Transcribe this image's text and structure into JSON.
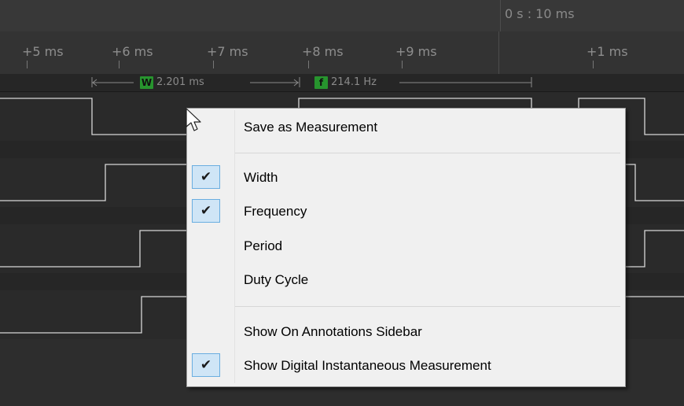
{
  "timeline": {
    "origin_label": "0 s : 10 ms",
    "ticks": [
      "+5 ms",
      "+6 ms",
      "+7 ms",
      "+8 ms",
      "+9 ms",
      "+1 ms"
    ]
  },
  "measurement_bar": {
    "width": {
      "badge": "W",
      "value": "2.201 ms"
    },
    "frequency": {
      "badge": "f",
      "value": "214.1 Hz"
    }
  },
  "context_menu": {
    "items": [
      {
        "label": "Save as Measurement",
        "checked": false
      },
      {
        "label": "Width",
        "checked": true
      },
      {
        "label": "Frequency",
        "checked": true
      },
      {
        "label": "Period",
        "checked": false
      },
      {
        "label": "Duty Cycle",
        "checked": false
      },
      {
        "label": "Show On Annotations Sidebar",
        "checked": false
      },
      {
        "label": "Show Digital Instantaneous Measurement",
        "checked": true
      }
    ],
    "check_glyph": "✔"
  },
  "colors": {
    "background": "#2d2d2d",
    "waveform": "#dcdcdc",
    "badge_green": "#27942e",
    "check_highlight": "#cfe5f6"
  },
  "icons": [
    "mouse-pointer-icon",
    "checkmark-icon"
  ]
}
